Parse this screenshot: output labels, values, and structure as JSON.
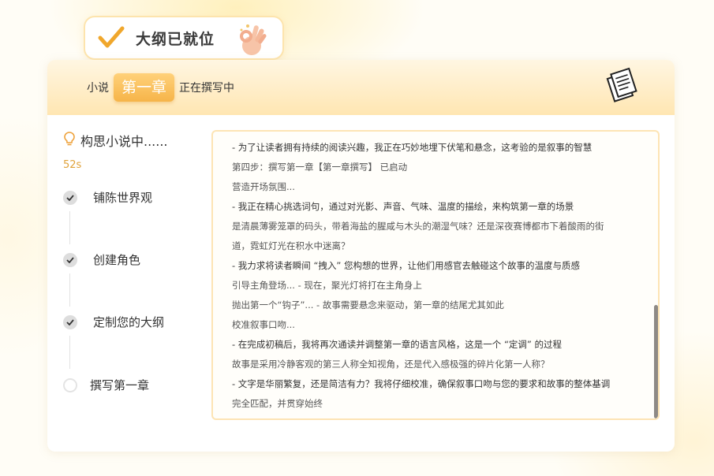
{
  "badge": {
    "title": "大纲已就位",
    "check_icon": "checkmark-icon",
    "hand_icon": "ok-hand-icon"
  },
  "header": {
    "prefix": "小说",
    "chapter": "第一章",
    "suffix": "正在撰写中",
    "doc_icon": "documents-icon"
  },
  "progress": {
    "thinking_label": "构思小说中......",
    "thinking_icon": "lightbulb-icon",
    "elapsed": "52s",
    "steps": [
      {
        "label": "铺陈世界观",
        "status": "done"
      },
      {
        "label": "创建角色",
        "status": "done"
      },
      {
        "label": "定制您的大纲",
        "status": "done"
      },
      {
        "label": "撰写第一章",
        "status": "pending"
      }
    ]
  },
  "log": {
    "lines": [
      "- 为了让读者拥有持续的阅读兴趣，我正在巧妙地埋下伏笔和悬念，这考验的是叙事的智慧",
      "第四步：撰写第一章【第一章撰写】 已启动",
      "营造开场氛围...",
      "- 我正在精心挑选词句，通过对光影、声音、气味、温度的描绘，来构筑第一章的场景",
      "是清晨薄雾笼罩的码头，带着海盐的腥咸与木头的潮湿气味？还是深夜赛博都市下着酸雨的街",
      "道，霓虹灯光在积水中迷离？",
      "- 我力求将读者瞬间 “拽入” 您构想的世界，让他们用感官去触碰这个故事的温度与质感",
      "引导主角登场... - 现在，聚光灯将打在主角身上",
      "抛出第一个“钩子”... - 故事需要悬念来驱动，第一章的结尾尤其如此",
      "校准叙事口吻...",
      "- 在完成初稿后，我将再次通读并调整第一章的语言风格，这是一个 “定调” 的过程",
      "故事是采用冷静客观的第三人称全知视角，还是代入感极强的碎片化第一人称？",
      "- 文字是华丽繁复，还是简洁有力？我将仔细校准，确保叙事口吻与您的要求和故事的整体基调",
      "完全匹配，并贯穿始终"
    ]
  }
}
